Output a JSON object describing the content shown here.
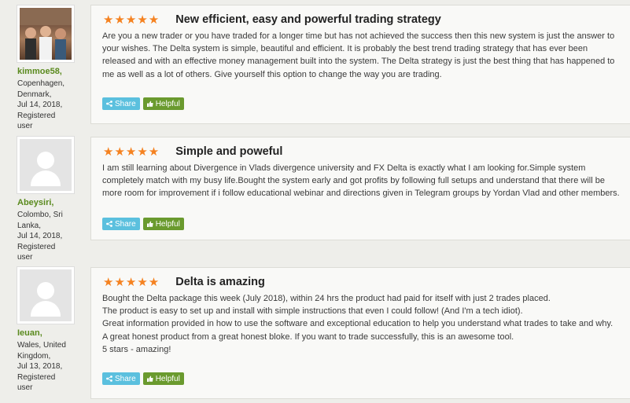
{
  "reviews": [
    {
      "username": "kimmoe58,",
      "meta": [
        "Copenhagen,",
        "Denmark,",
        "Jul 14, 2018,",
        "Registered user"
      ],
      "stars": "★★★★★",
      "title": "New efficient, easy and powerful trading strategy",
      "body": [
        "Are you a new trader or you have traded for a longer time but has not achieved the success then this new system is just the answer to your wishes. The Delta system is simple, beautiful and efficient. It is probably the best trend trading strategy that has ever been released and with an effective money management built into the system. The Delta strategy is just the best thing that has happened to me as well as a lot of others. Give yourself this option to change the way you are trading."
      ],
      "share_label": "Share",
      "helpful_label": "Helpful"
    },
    {
      "username": "Abeysiri,",
      "meta": [
        "Colombo, Sri",
        "Lanka,",
        "Jul 14, 2018,",
        "Registered user"
      ],
      "stars": "★★★★★",
      "title": "Simple and poweful",
      "body": [
        "I am still learning about Divergence in Vlads divergence university and FX Delta is exactly what I am looking for.Simple system completely match with my busy life.Bought the system early and got profits by following full setups and understand that there will be more room for improvement if i follow educational webinar and directions given in Telegram groups by Yordan Vlad and other members."
      ],
      "share_label": "Share",
      "helpful_label": "Helpful"
    },
    {
      "username": "Ieuan,",
      "meta": [
        "Wales, United",
        "Kingdom,",
        "Jul 13, 2018,",
        "Registered user"
      ],
      "stars": "★★★★★",
      "title": "Delta is amazing",
      "body": [
        "Bought the Delta package this week (July 2018), within 24 hrs the product had paid for itself with just 2 trades placed.",
        "The product is easy to set up and install with simple instructions that even I could follow! (And I'm a tech idiot).",
        "Great information provided in how to use the software and exceptional education to help you understand what trades to take and why.",
        "A great honest product from a great honest bloke. If you want to trade successfully, this is an awesome tool.",
        "5 stars - amazing!"
      ],
      "share_label": "Share",
      "helpful_label": "Helpful"
    }
  ],
  "icons": {
    "share": "share-icon",
    "helpful": "thumbs-up-icon",
    "star": "star-icon"
  },
  "colors": {
    "stars": "#f58220",
    "username": "#5a8a1e",
    "share": "#5bc0de",
    "helpful": "#6a9a2e"
  }
}
